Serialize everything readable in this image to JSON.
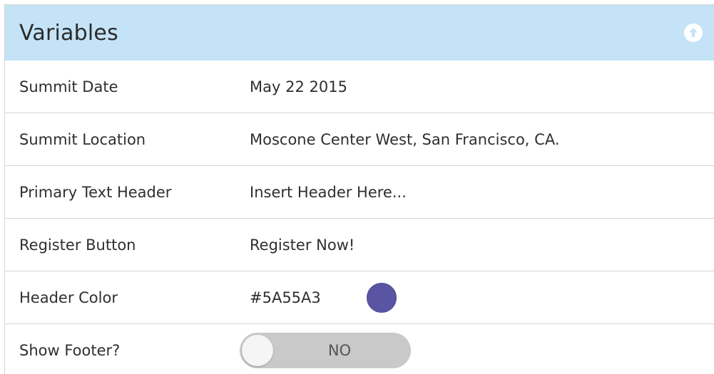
{
  "panel": {
    "title": "Variables",
    "collapse_icon": "arrow-up-circle-icon"
  },
  "rows": [
    {
      "label": "Summit Date",
      "value": "May 22 2015"
    },
    {
      "label": "Summit Location",
      "value": "Moscone Center West, San Francisco, CA."
    },
    {
      "label": "Primary Text Header",
      "value": "Insert Header Here..."
    },
    {
      "label": "Register Button",
      "value": "Register Now!"
    },
    {
      "label": "Header Color",
      "value": "#5A55A3",
      "swatch_color": "#5A55A3"
    },
    {
      "label": "Show Footer?",
      "toggle_text": "NO",
      "toggle_on": false
    }
  ],
  "colors": {
    "header_bg": "#c4e3f6",
    "toggle_off": "#c9c9c9"
  }
}
